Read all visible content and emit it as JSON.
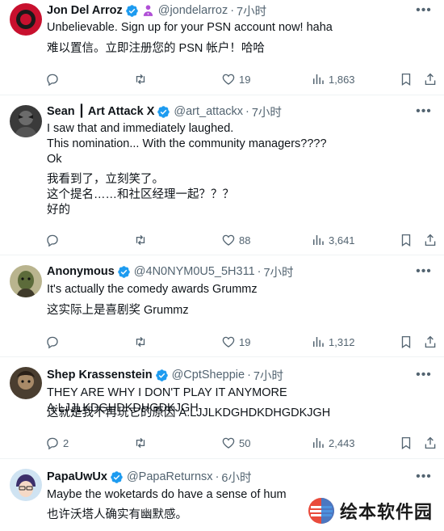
{
  "brand_color": "#1d9bf0",
  "posts": [
    {
      "name": "Jon Del Arroz",
      "handle": "@jondelarroz",
      "dot": "·",
      "time": "7小时",
      "extra_badge": "person-emoji",
      "lines": "Unbelievable.  Sign up for your PSN account now! haha",
      "translation": "难以置信。立即注册您的 PSN 帐户！哈哈",
      "replies": "",
      "retweets": "",
      "likes": "19",
      "views": "1,863"
    },
    {
      "name": "Sean ┃ Art Attack X",
      "handle": "@art_attackx",
      "dot": "·",
      "time": "7小时",
      "lines": "I saw that and immediately laughed.\nThis nomination... With the community managers????\nOk",
      "translation": "我看到了，立刻笑了。\n这个提名……和社区经理一起？？？\n好的",
      "replies": "",
      "retweets": "",
      "likes": "88",
      "views": "3,641"
    },
    {
      "name": "Anonymous",
      "handle": "@4N0NYM0U5_5H311",
      "dot": "·",
      "time": "7小时",
      "lines": "It's actually the comedy awards Grummz",
      "translation": "这实际上是喜剧奖 Grummz",
      "replies": "",
      "retweets": "",
      "likes": "19",
      "views": "1,312"
    },
    {
      "name": "Shep Krassenstein",
      "handle": "@CptSheppie",
      "dot": "·",
      "time": "7小时",
      "lines": "THEY ARE WHY I DON'T PLAY IT ANYMORE A:LJJLKDGHDKDHGDKJGH",
      "translation": "这就是我不再玩它的原因 A:LJJLKDGHDKDHGDKJGH",
      "replies": "2",
      "retweets": "",
      "likes": "50",
      "views": "2,443"
    },
    {
      "name": "PapaUwUx",
      "handle": "@PapaReturnsx",
      "dot": "·",
      "time": "6小时",
      "lines": "Maybe the woketards do have a sense of hum",
      "translation": "也许沃塔人确实有幽默感。"
    }
  ],
  "watermark": {
    "text": "绘本软件园"
  },
  "icons": {
    "more": "more-horizontal-icon",
    "reply": "reply-icon",
    "retweet": "retweet-icon",
    "like": "heart-icon",
    "views": "views-chart-icon",
    "bookmark": "bookmark-icon",
    "share": "share-icon",
    "verified": "verified-badge-icon"
  }
}
